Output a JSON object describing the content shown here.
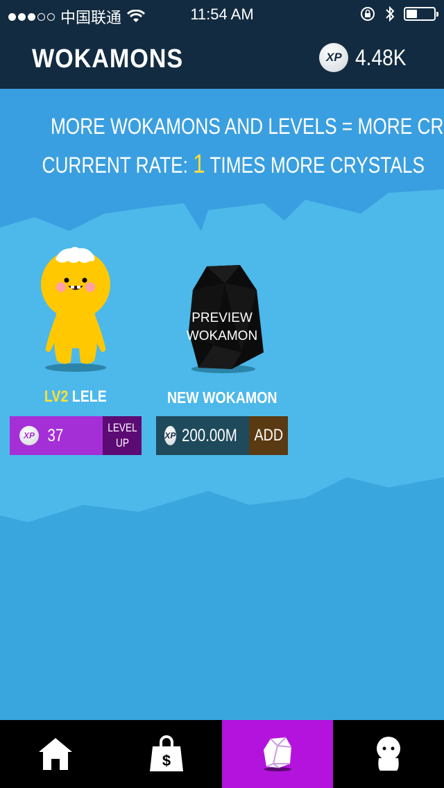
{
  "status_bar": {
    "carrier": "中国联通",
    "time": "11:54 AM"
  },
  "header": {
    "title": "WOKAMONS",
    "xp_coin_label": "XP",
    "xp_total": "4.48K"
  },
  "main": {
    "line1": "MORE WOKAMONS AND LEVELS = MORE CRYSTALS",
    "rate_prefix": "CURRENT RATE:",
    "rate_value": "1",
    "rate_suffix": "TIMES MORE CRYSTALS"
  },
  "cards": {
    "owned": {
      "level": "LV2",
      "name": "LELE",
      "xp_cost": "37",
      "button_line1": "LEVEL",
      "button_line2": "UP"
    },
    "new": {
      "name": "NEW WOKAMON",
      "preview_line1": "PREVIEW",
      "preview_line2": "WOKAMON",
      "xp_cost": "200.00M",
      "button": "ADD"
    }
  },
  "colors": {
    "header_bg": "#122b40",
    "sky": "#3aa0dc",
    "accent_purple": "#b313dc",
    "level_button_purple": "#a52fd6",
    "highlight_yellow": "#ffe135",
    "monster_yellow": "#ffc800"
  },
  "nav": [
    {
      "name": "home",
      "icon": "house-icon",
      "active": false
    },
    {
      "name": "shop",
      "icon": "shopping-bag-icon",
      "active": false
    },
    {
      "name": "wokamons",
      "icon": "crystal-icon",
      "active": true
    },
    {
      "name": "profile",
      "icon": "avatar-icon",
      "active": false
    }
  ]
}
